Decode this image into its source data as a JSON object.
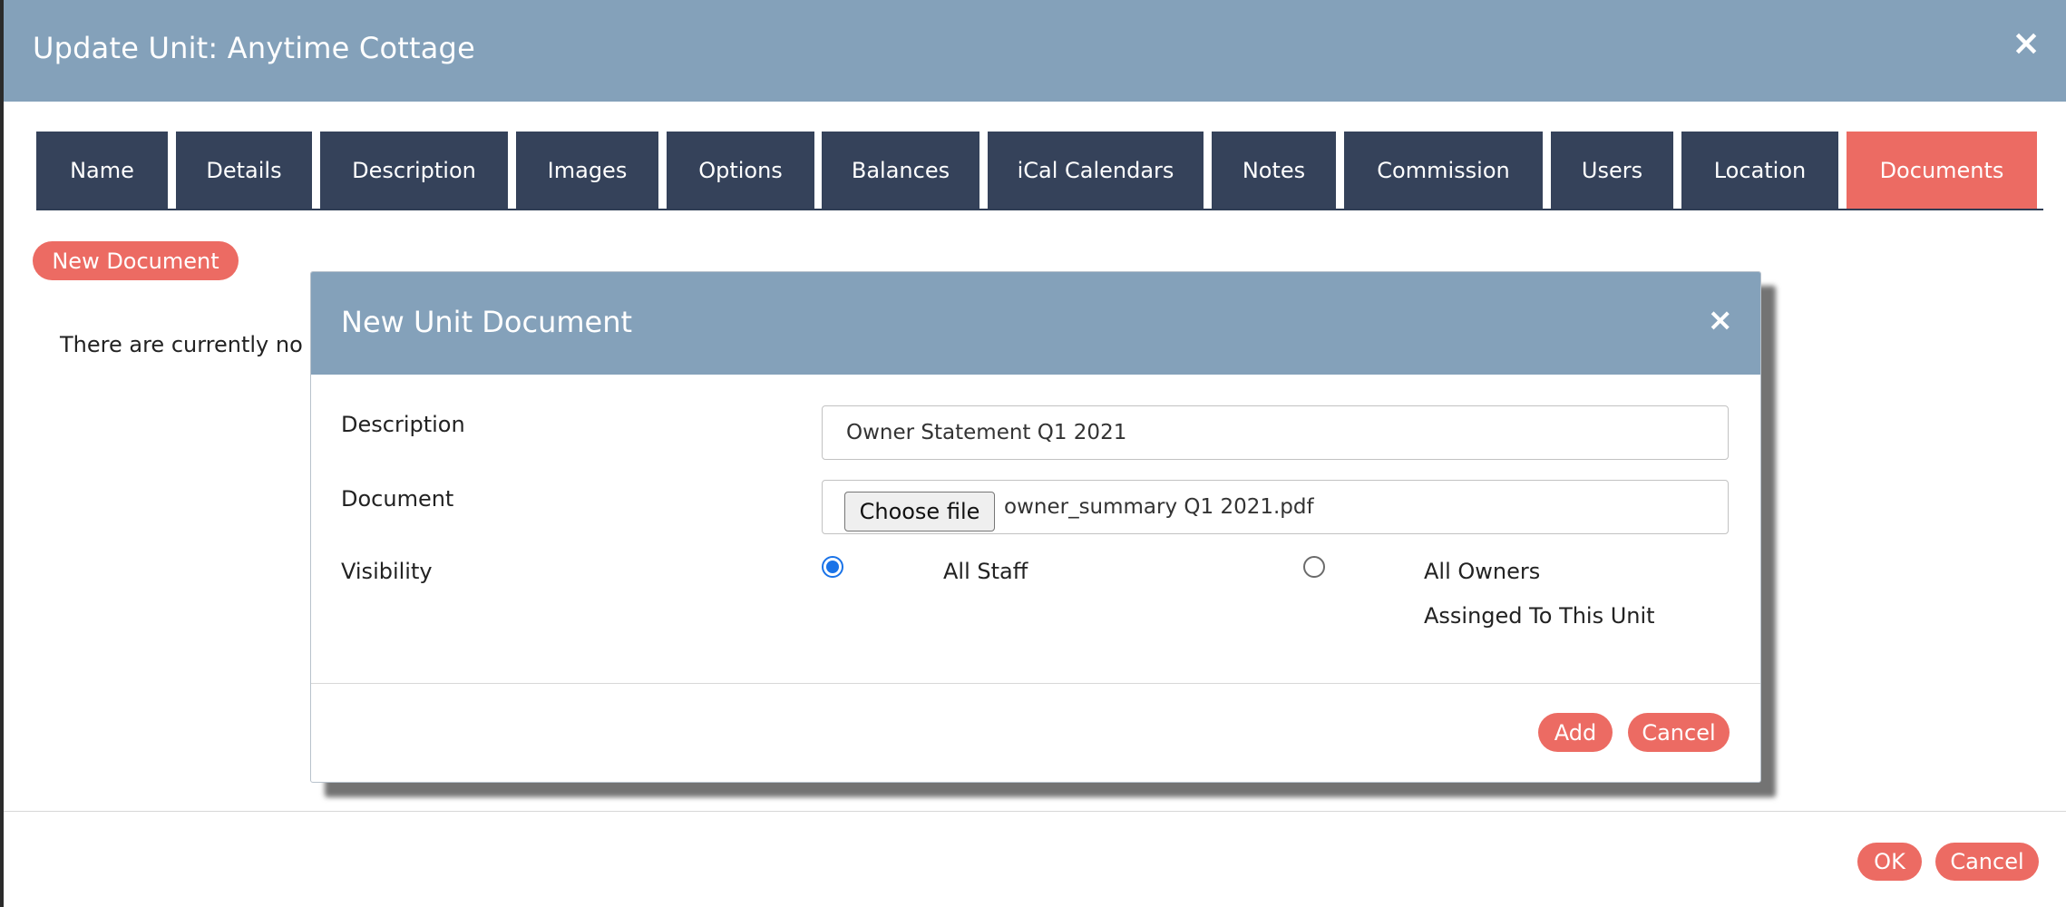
{
  "window": {
    "title": "Update Unit: Anytime Cottage",
    "close_label": "×"
  },
  "tabs": [
    {
      "label": "Name"
    },
    {
      "label": "Details"
    },
    {
      "label": "Description"
    },
    {
      "label": "Images"
    },
    {
      "label": "Options"
    },
    {
      "label": "Balances"
    },
    {
      "label": "iCal Calendars"
    },
    {
      "label": "Notes"
    },
    {
      "label": "Commission"
    },
    {
      "label": "Users"
    },
    {
      "label": "Location"
    },
    {
      "label": "Documents",
      "active": true
    }
  ],
  "documents": {
    "new_button_label": "New Document",
    "empty_text_visible": "There are currently no d"
  },
  "footer": {
    "ok_label": "OK",
    "cancel_label": "Cancel"
  },
  "dialog": {
    "title": "New Unit Document",
    "close_label": "×",
    "description_label": "Description",
    "description_value": "Owner Statement Q1 2021",
    "document_label": "Document",
    "choose_file_label": "Choose file",
    "file_name": "owner_summary Q1 2021.pdf",
    "visibility_label": "Visibility",
    "visibility_options": [
      {
        "label": "All Staff",
        "selected": true
      },
      {
        "label_line1": "All Owners",
        "label_line2": "Assinged To This Unit",
        "selected": false
      }
    ],
    "add_label": "Add",
    "cancel_label": "Cancel"
  },
  "colors": {
    "header": "#84a1ba",
    "tab": "#35425a",
    "accent": "#ec6b63",
    "radio_selected": "#1a73e8"
  }
}
